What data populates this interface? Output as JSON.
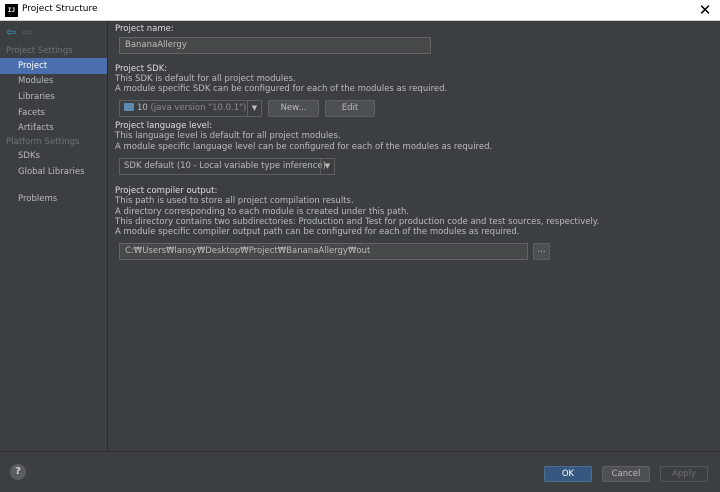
{
  "window": {
    "title": "Project Structure",
    "app_icon_text": "IJ"
  },
  "sidebar": {
    "section_project_settings": "Project Settings",
    "project_items": [
      {
        "label": "Project",
        "selected": true
      },
      {
        "label": "Modules"
      },
      {
        "label": "Libraries"
      },
      {
        "label": "Facets"
      },
      {
        "label": "Artifacts"
      }
    ],
    "section_platform_settings": "Platform Settings",
    "platform_items": [
      {
        "label": "SDKs"
      },
      {
        "label": "Global Libraries"
      }
    ],
    "problems": "Problems"
  },
  "main": {
    "project_name_label": "Project name:",
    "project_name_value": "BananaAllergy",
    "sdk": {
      "label": "Project SDK:",
      "desc1": "This SDK is default for all project modules.",
      "desc2": "A module specific SDK can be configured for each of the modules as required.",
      "selected_version": "10",
      "selected_detail": "(java version \"10.0.1\")",
      "new_button": "New...",
      "edit_button": "Edit"
    },
    "language_level": {
      "label": "Project language level:",
      "desc1": "This language level is default for all project modules.",
      "desc2": "A module specific language level can be configured for each of the modules as required.",
      "selected": "SDK default (10 - Local variable type inference)"
    },
    "compiler_output": {
      "label": "Project compiler output:",
      "desc1": "This path is used to store all project compilation results.",
      "desc2": "A directory corresponding to each module is created under this path.",
      "desc3": "This directory contains two subdirectories: Production and Test for production code and test sources, respectively.",
      "desc4": "A module specific compiler output path can be configured for each of the modules as required.",
      "path": "C:₩Users₩lansy₩Desktop₩Project₩BananaAllergy₩out",
      "browse_button": "..."
    }
  },
  "footer": {
    "help": "?",
    "ok": "OK",
    "cancel": "Cancel",
    "apply": "Apply"
  },
  "colors": {
    "background": "#3c3f41",
    "selection": "#4b6eaf",
    "ok_button": "#365880",
    "nav_arrow_active": "#3592c4"
  },
  "icons": {
    "back": "arrow-left-icon",
    "forward": "arrow-right-icon",
    "sdk": "jdk-folder-icon",
    "help": "help-circle-icon",
    "dropdown": "chevron-down-icon"
  }
}
